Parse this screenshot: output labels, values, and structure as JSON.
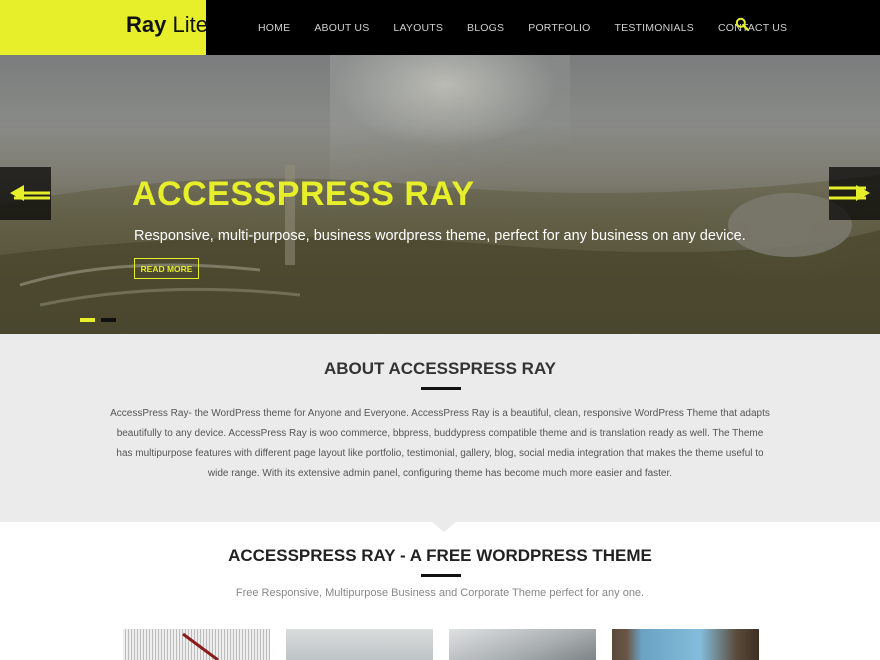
{
  "header": {
    "logo_bold": "Ray",
    "logo_light": "Lite",
    "nav": [
      "HOME",
      "ABOUT US",
      "LAYOUTS",
      "BLOGS",
      "PORTFOLIO",
      "TESTIMONIALS",
      "CONTACT US"
    ]
  },
  "hero": {
    "title": "ACCESSPRESS RAY",
    "subtitle": "Responsive, multi-purpose, business wordpress theme, perfect for any business on any device.",
    "button": "READ MORE",
    "slides_total": 2,
    "active_slide": 1
  },
  "about": {
    "title": "ABOUT ACCESSPRESS RAY",
    "text": "AccessPress Ray- the WordPress theme for Anyone and Everyone. AccessPress Ray is a beautiful, clean, responsive WordPress Theme that adapts beautifully to any device. AccessPress Ray is woo commerce, bbpress, buddypress compatible theme and is translation ready as well. The Theme has multipurpose features with different page layout like portfolio, testimonial, gallery, blog, social media integration that makes the theme useful to wide range. With its extensive admin panel, configuring theme has become much more easier and faster."
  },
  "free_theme": {
    "title": "ACCESSPRESS RAY - A FREE WORDPRESS THEME",
    "subtitle": "Free Responsive, Multipurpose Business and Corporate Theme perfect for any one."
  },
  "colors": {
    "accent": "#e6ef2a",
    "header_bg": "#000000",
    "about_bg": "#ebebeb"
  },
  "icons": {
    "search": "search-icon",
    "prev": "arrow-left-icon",
    "next": "arrow-right-icon"
  }
}
